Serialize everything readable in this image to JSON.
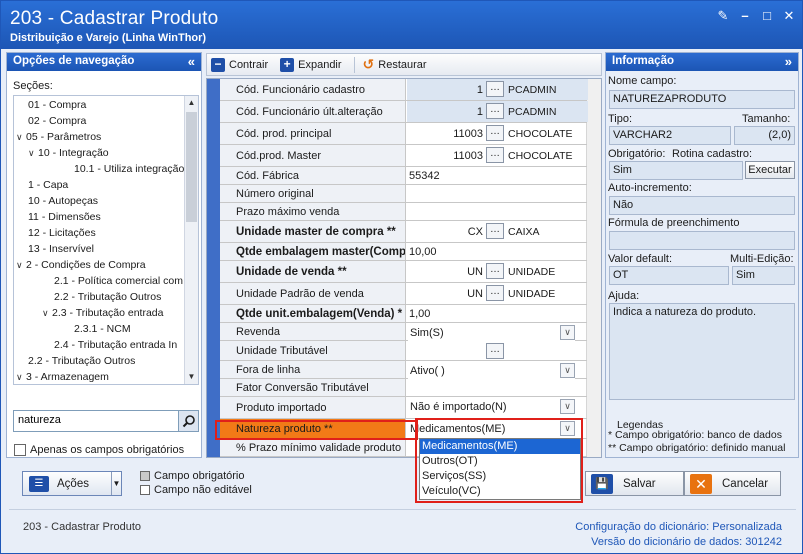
{
  "window": {
    "title": "203 - Cadastrar  Produto",
    "subtitle": "Distribuição e Varejo (Linha WinThor)"
  },
  "nav": {
    "header": "Opções de navegação",
    "sections_label": "Seções:",
    "items": [
      {
        "label": "01 - Compra",
        "toggle": ""
      },
      {
        "label": "02 - Compra",
        "toggle": ""
      },
      {
        "label": "05 - Parâmetros",
        "toggle": "v"
      },
      {
        "label": "10 - Integração",
        "toggle": "v"
      },
      {
        "label": "10.1 - Utiliza integração",
        "toggle": ""
      },
      {
        "label": "1 - Capa",
        "toggle": ""
      },
      {
        "label": "10 - Autopeças",
        "toggle": ""
      },
      {
        "label": "11 - Dimensões",
        "toggle": ""
      },
      {
        "label": "12 - Licitações",
        "toggle": ""
      },
      {
        "label": "13 - Inservível",
        "toggle": ""
      },
      {
        "label": "2 - Condições de Compra",
        "toggle": "v"
      },
      {
        "label": "2.1 - Política comercial com",
        "toggle": ""
      },
      {
        "label": "2.2 - Tributação Outros",
        "toggle": ""
      },
      {
        "label": "2.3 - Tributação entrada",
        "toggle": "v"
      },
      {
        "label": "2.3.1 - NCM",
        "toggle": ""
      },
      {
        "label": "2.4 - Tributação entrada In",
        "toggle": ""
      },
      {
        "label": "2.2 - Tributação Outros",
        "toggle": ""
      },
      {
        "label": "3 - Armazenagem",
        "toggle": "v"
      }
    ],
    "search_value": "natureza",
    "only_required_label": "Apenas os campos obrigatórios"
  },
  "toolbar": {
    "collapse": "Contrair",
    "expand": "Expandir",
    "restore": "Restaurar"
  },
  "grid": {
    "rows": [
      {
        "label": "Cód. Funcionário cadastro",
        "kind": "lookup",
        "num": "1",
        "text": "PCADMIN",
        "blue": true
      },
      {
        "label": "Cód. Funcionário últ.alteração",
        "kind": "lookup",
        "num": "1",
        "text": "PCADMIN",
        "blue": true
      },
      {
        "label": "Cód. prod. principal",
        "kind": "lookup",
        "num": "11003",
        "text": "CHOCOLATE"
      },
      {
        "label": "Cód.prod. Master",
        "kind": "lookup",
        "num": "11003",
        "text": "CHOCOLATE"
      },
      {
        "label": "Cód. Fábrica",
        "kind": "text",
        "value": "55342"
      },
      {
        "label": "Número original",
        "kind": "text",
        "value": ""
      },
      {
        "label": "Prazo máximo venda",
        "kind": "text",
        "value": ""
      },
      {
        "label": "Unidade master de compra **",
        "kind": "lookup",
        "num": "CX",
        "text": "CAIXA",
        "bold": true
      },
      {
        "label": "Qtde embalagem master(Comp",
        "kind": "text",
        "value": "10,00",
        "bold": true
      },
      {
        "label": "Unidade de venda **",
        "kind": "lookup",
        "num": "UN",
        "text": "UNIDADE",
        "bold": true
      },
      {
        "label": "Unidade Padrão de venda",
        "kind": "lookup",
        "num": "UN",
        "text": "UNIDADE"
      },
      {
        "label": "Qtde unit.embalagem(Venda) *",
        "kind": "text",
        "value": "1,00",
        "bold": true
      },
      {
        "label": "Revenda",
        "kind": "combo",
        "value": "Sim(S)"
      },
      {
        "label": "Unidade Tributável",
        "kind": "dots",
        "value": ""
      },
      {
        "label": "Fora de linha",
        "kind": "combo",
        "value": "Ativo( )"
      },
      {
        "label": "Fator Conversão Tributável",
        "kind": "text",
        "value": ""
      },
      {
        "label": "Produto importado",
        "kind": "combo",
        "value": "Não é importado(N)"
      },
      {
        "label": "Natureza produto **",
        "kind": "combo",
        "value": "Medicamentos(ME)",
        "highlight": true
      },
      {
        "label": "% Prazo mínimo validade produto",
        "kind": "text",
        "value": ""
      }
    ],
    "dropdown_options": [
      "Medicamentos(ME)",
      "Outros(OT)",
      "Serviços(SS)",
      "Veículo(VC)"
    ],
    "dropdown_selected": "Medicamentos(ME)"
  },
  "info": {
    "header": "Informação",
    "field_name_label": "Nome campo:",
    "field_name": "NATUREZAPRODUTO",
    "type_label": "Tipo:",
    "type": "VARCHAR2",
    "size_label": "Tamanho:",
    "size": "(2,0)",
    "required_label": "Obrigatório:",
    "required": "Sim",
    "routine_label": "Rotina cadastro:",
    "execute": "Executar",
    "autoinc_label": "Auto-incremento:",
    "autoinc": "Não",
    "formula_label": "Fórmula de preenchimento",
    "formula": "",
    "default_label": "Valor default:",
    "default": "OT",
    "multiedit_label": "Multi-Edição:",
    "multiedit": "Sim",
    "help_label": "Ajuda:",
    "help": "Indica a natureza do produto.",
    "legend_title": "Legendas",
    "legend1": "* Campo obrigatório: banco de dados",
    "legend2": "** Campo obrigatório: definido manual"
  },
  "bottom": {
    "actions": "Ações",
    "legend_required": "Campo obrigatório",
    "legend_noneditable": "Campo não editável",
    "save": "Salvar",
    "cancel": "Cancelar"
  },
  "footer": {
    "routine": "203 - Cadastrar  Produto",
    "dict_config_label": "Configuração do dicionário:",
    "dict_config": "Personalizada",
    "dict_version_label": "Versão do dicionário de dados:",
    "dict_version": "301242"
  },
  "colors": {
    "titlebar": "#1d56b5",
    "highlight": "#f27a17",
    "red_box": "#e0201a",
    "selected": "#1c66d3"
  }
}
